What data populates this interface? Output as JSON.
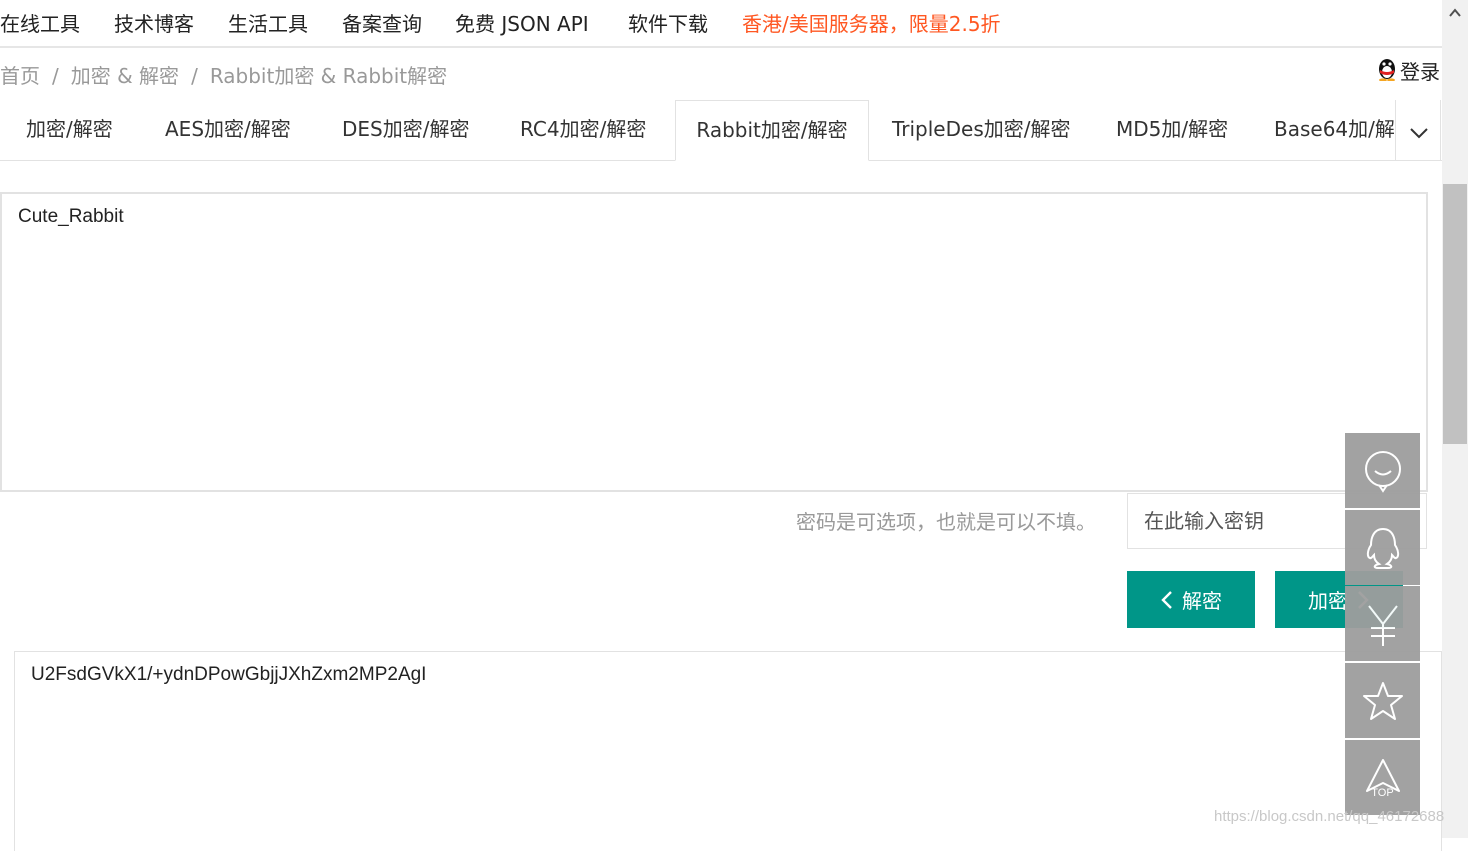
{
  "topnav": {
    "items": [
      "在线工具",
      "技术博客",
      "生活工具",
      "备案查询",
      "免费 JSON API",
      "软件下载"
    ],
    "promo": "香港/美国服务器，限量2.5折"
  },
  "breadcrumb": {
    "home": "首页",
    "sep": "/",
    "category": "加密 & 解密",
    "current": "Rabbit加密 & Rabbit解密"
  },
  "login": {
    "label": "登录",
    "icon": "qq-penguin-icon"
  },
  "tabs": [
    {
      "label": "加密/解密"
    },
    {
      "label": "AES加密/解密"
    },
    {
      "label": "DES加密/解密"
    },
    {
      "label": "RC4加密/解密"
    },
    {
      "label": "Rabbit加密/解密",
      "active": true
    },
    {
      "label": "TripleDes加密/解密"
    },
    {
      "label": "MD5加/解密"
    },
    {
      "label": "Base64加/解"
    }
  ],
  "input": {
    "value": "Cute_Rabbit"
  },
  "key": {
    "hint": "密码是可选项，也就是可以不填。",
    "placeholder": "在此输入密钥"
  },
  "buttons": {
    "decrypt": "解密",
    "encrypt": "加密"
  },
  "output": {
    "value": "U2FsdGVkX1/+ydnDPowGbjjJXhZxm2MP2AgI"
  },
  "sidebar": {
    "items": [
      "chat-bubble-icon",
      "qq-icon",
      "yuan-icon",
      "star-icon",
      "top-arrow-icon"
    ],
    "top_label": "TOP"
  },
  "watermark": "https://blog.csdn.net/qq_46172688",
  "colors": {
    "accent": "#009688",
    "promo": "#ff5722",
    "sidebar": "#9e9e9e"
  }
}
